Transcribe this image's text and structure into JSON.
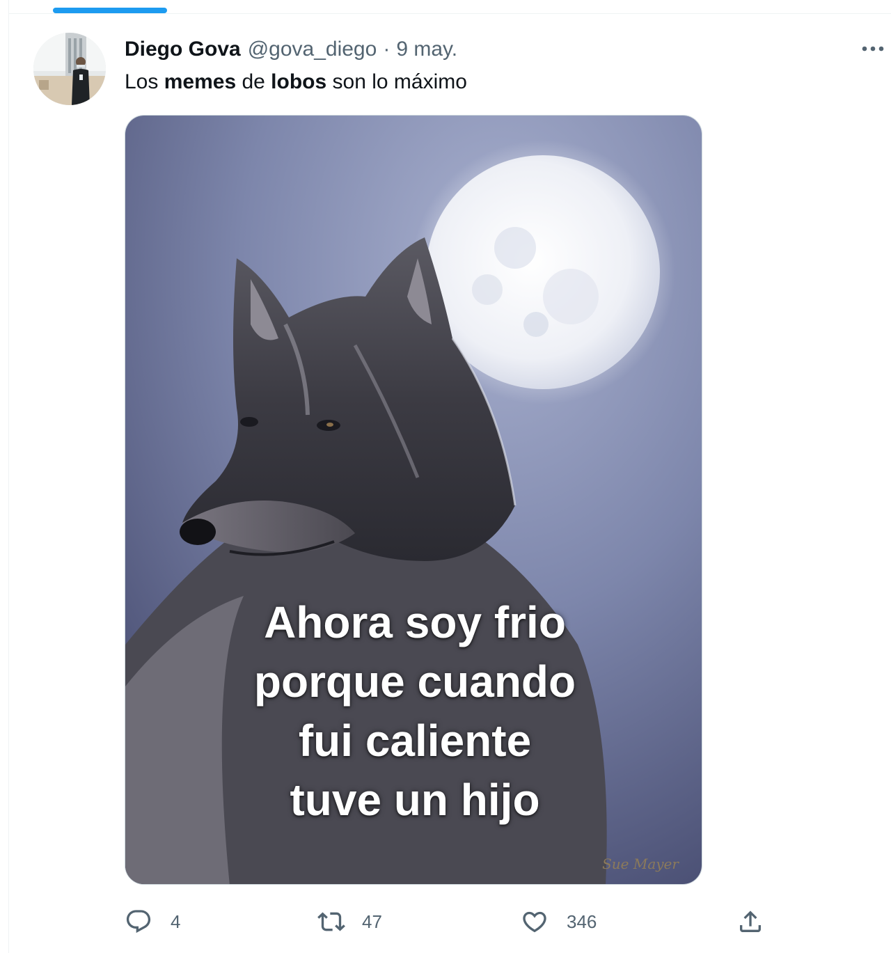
{
  "tweet": {
    "display_name": "Diego Gova",
    "handle": "@gova_diego",
    "separator": "·",
    "date": "9 may.",
    "text_parts": [
      "Los ",
      "memes",
      " de ",
      "lobos",
      " son lo máximo"
    ],
    "more_icon": "more-horizontal-icon"
  },
  "media": {
    "caption_lines": [
      "Ahora soy frio",
      "porque cuando",
      "fui caliente",
      "tuve un hijo"
    ],
    "signature": "Sue Mayer"
  },
  "actions": {
    "reply": {
      "icon": "reply-icon",
      "count": "4"
    },
    "retweet": {
      "icon": "retweet-icon",
      "count": "47"
    },
    "like": {
      "icon": "heart-icon",
      "count": "346"
    },
    "share": {
      "icon": "share-icon"
    }
  },
  "colors": {
    "accent": "#1d9bf0",
    "muted": "#536471",
    "text": "#0f1419"
  }
}
